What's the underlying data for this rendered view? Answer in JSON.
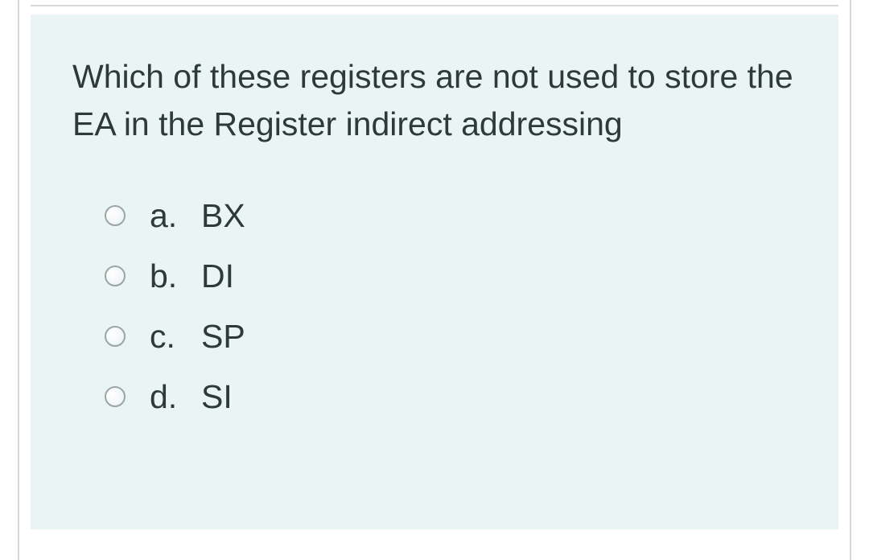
{
  "question": {
    "text": "Which of these registers are not used to store the EA in the Register indirect addressing",
    "options": [
      {
        "letter": "a.",
        "text": "BX"
      },
      {
        "letter": "b.",
        "text": "DI"
      },
      {
        "letter": "c.",
        "text": "SP"
      },
      {
        "letter": "d.",
        "text": "SI"
      }
    ]
  }
}
